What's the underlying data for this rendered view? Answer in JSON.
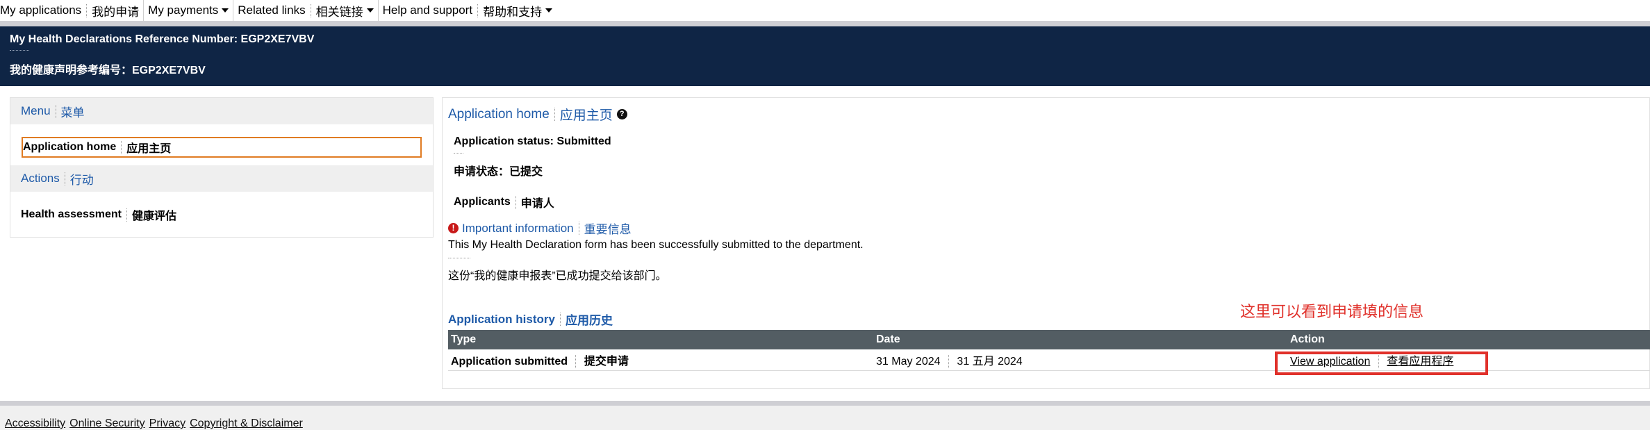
{
  "topnav": {
    "my_applications": "My applications",
    "my_applications_zh": "我的申请",
    "my_payments": "My payments",
    "related_links": "Related links",
    "related_links_zh": "相关链接",
    "help": "Help and support",
    "help_zh": "帮助和支持"
  },
  "banner": {
    "ref_en": "My Health Declarations Reference Number: EGP2XE7VBV",
    "ref_zh": "我的健康声明参考编号：EGP2XE7VBV"
  },
  "menu": {
    "head_en": "Menu",
    "head_zh": "菜单",
    "home_en": "Application home",
    "home_zh": "应用主页",
    "actions_en": "Actions",
    "actions_zh": "行动",
    "health_en": "Health assessment",
    "health_zh": "健康评估"
  },
  "main": {
    "title_en": "Application home",
    "title_zh": "应用主页",
    "help_icon": "?",
    "status_en": "Application status: Submitted",
    "status_zh": "申请状态：已提交",
    "applicants_en": "Applicants",
    "applicants_zh": "申请人",
    "error_icon": "!",
    "important_en": "Important information",
    "important_zh": "重要信息",
    "message_en": "This My Health Declaration form has been successfully submitted to the department.",
    "message_zh": "这份“我的健康申报表”已成功提交给该部门。",
    "history_en": "Application history",
    "history_zh": "应用历史",
    "annotation": "这里可以看到申请填的信息"
  },
  "history_table": {
    "headers": [
      "Type",
      "Date",
      "Action"
    ],
    "rows": [
      {
        "type_en": "Application submitted",
        "type_zh": "提交申请",
        "date_en": "31 May 2024",
        "date_zh": "31 五月 2024",
        "action_en": "View application",
        "action_zh": "查看应用程序"
      }
    ]
  },
  "footer": {
    "accessibility": "Accessibility",
    "online_security": "Online Security",
    "privacy": "Privacy",
    "copyright": "Copyright & Disclaimer"
  },
  "colors": {
    "banner_bg": "#0f2545",
    "link": "#1e5aa8",
    "table_header": "#535d63",
    "highlight_orange": "#e07b22",
    "annotation_red": "#e0302a"
  }
}
